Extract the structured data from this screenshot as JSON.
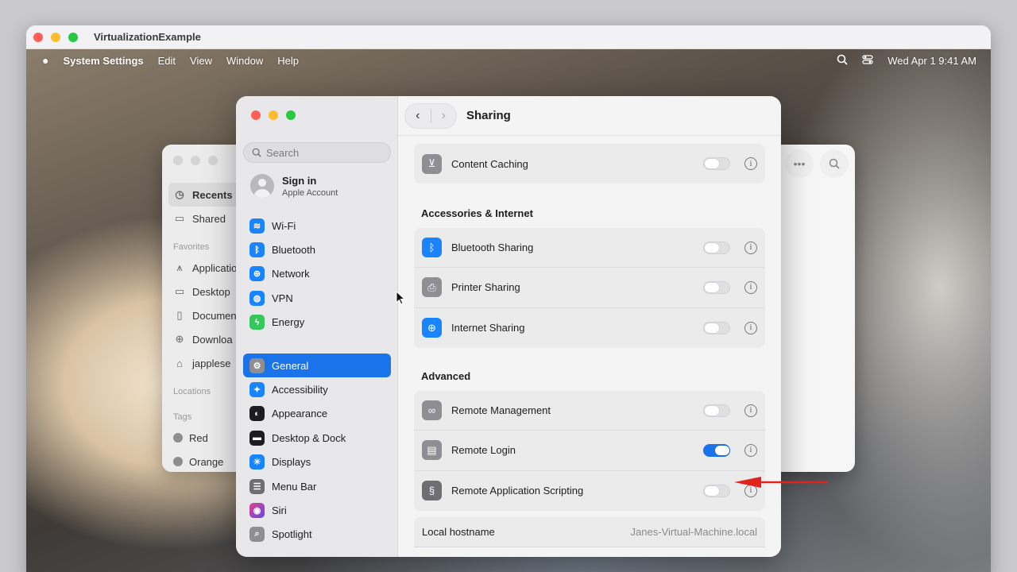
{
  "host_window": {
    "title": "VirtualizationExample"
  },
  "menubar": {
    "apple": "",
    "app_name": "System Settings",
    "menus": [
      "Edit",
      "View",
      "Window",
      "Help"
    ],
    "clock": "Wed Apr 1  9:41 AM"
  },
  "finder": {
    "items": [
      {
        "label": "Recents",
        "icon": "clock-icon"
      },
      {
        "label": "Shared",
        "icon": "shared-folder-icon"
      }
    ],
    "favorites_label": "Favorites",
    "favorites": [
      {
        "label": "Applicatio",
        "icon": "applications-icon"
      },
      {
        "label": "Desktop",
        "icon": "desktop-icon"
      },
      {
        "label": "Documen",
        "icon": "document-icon"
      },
      {
        "label": "Downloa",
        "icon": "download-icon"
      },
      {
        "label": "japplese",
        "icon": "home-icon"
      }
    ],
    "locations_label": "Locations",
    "tags_label": "Tags",
    "tags": [
      {
        "label": "Red"
      },
      {
        "label": "Orange"
      }
    ]
  },
  "settings": {
    "search_placeholder": "Search",
    "account": {
      "name": "Sign in",
      "sub": "Apple Account"
    },
    "sidebar_top": [
      {
        "label": "Wi-Fi",
        "icon": "wifi-icon",
        "color": "#1a84ff"
      },
      {
        "label": "Bluetooth",
        "icon": "bluetooth-icon",
        "color": "#1a84ff"
      },
      {
        "label": "Network",
        "icon": "globe-icon",
        "color": "#1a84ff"
      },
      {
        "label": "VPN",
        "icon": "vpn-icon",
        "color": "#1a84ff"
      },
      {
        "label": "Energy",
        "icon": "energy-icon",
        "color": "#34c759"
      }
    ],
    "sidebar_bottom": [
      {
        "label": "General",
        "icon": "gear-icon",
        "color": "#8e8e93",
        "selected": true
      },
      {
        "label": "Accessibility",
        "icon": "accessibility-icon",
        "color": "#1a84ff"
      },
      {
        "label": "Appearance",
        "icon": "appearance-icon",
        "color": "#1d1d1f"
      },
      {
        "label": "Desktop & Dock",
        "icon": "dock-icon",
        "color": "#1d1d1f"
      },
      {
        "label": "Displays",
        "icon": "sun-icon",
        "color": "#1a84ff"
      },
      {
        "label": "Menu Bar",
        "icon": "menubar-icon",
        "color": "#6e6e73"
      },
      {
        "label": "Siri",
        "icon": "siri-icon",
        "color": "#c1398a"
      },
      {
        "label": "Spotlight",
        "icon": "magnifier-icon",
        "color": "#8e8e93"
      }
    ],
    "header_title": "Sharing",
    "content_caching": {
      "label": "Content Caching",
      "on": false
    },
    "accessories_title": "Accessories & Internet",
    "accessories": [
      {
        "label": "Bluetooth Sharing",
        "icon": "bluetooth-icon",
        "color": "#1a84ff",
        "on": false
      },
      {
        "label": "Printer Sharing",
        "icon": "printer-icon",
        "color": "#8e8e93",
        "on": false
      },
      {
        "label": "Internet Sharing",
        "icon": "globe-icon",
        "color": "#1a84ff",
        "on": false
      }
    ],
    "advanced_title": "Advanced",
    "advanced": [
      {
        "label": "Remote Management",
        "icon": "binoculars-icon",
        "color": "#8e8e93",
        "on": false
      },
      {
        "label": "Remote Login",
        "icon": "terminal-icon",
        "color": "#8e8e93",
        "on": true
      },
      {
        "label": "Remote Application Scripting",
        "icon": "script-icon",
        "color": "#6e6e73",
        "on": false
      }
    ],
    "hostname_label": "Local hostname",
    "hostname_value": "Janes-Virtual-Machine.local"
  },
  "colors": {
    "accent": "#1a73e8",
    "annotation_arrow": "#e0241b"
  }
}
